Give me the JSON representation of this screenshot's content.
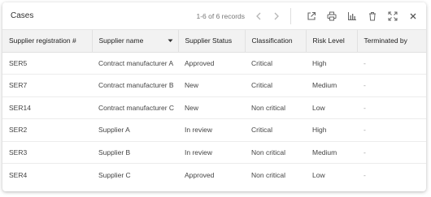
{
  "header": {
    "title": "Cases",
    "records": "1-6 of 6 records"
  },
  "toolbar": {
    "icons": [
      "external-link-icon",
      "print-icon",
      "bar-chart-icon",
      "trash-icon",
      "expand-icon",
      "close-icon"
    ]
  },
  "table": {
    "columns": [
      "Supplier registration #",
      "Supplier name",
      "Supplier Status",
      "Classification",
      "Risk Level",
      "Terminated by"
    ],
    "rows": [
      [
        "SER5",
        "Contract manufacturer A",
        "Approved",
        "Critical",
        "High",
        "-"
      ],
      [
        "SER7",
        "Contract manufacturer B",
        "New",
        "Critical",
        "Medium",
        "-"
      ],
      [
        "SER14",
        "Contract manufacturer C",
        "New",
        "Non critical",
        "Low",
        "-"
      ],
      [
        "SER2",
        "Supplier A",
        "In review",
        "Critical",
        "High",
        "-"
      ],
      [
        "SER3",
        "Supplier B",
        "In review",
        "Non critical",
        "Medium",
        "-"
      ],
      [
        "SER4",
        "Supplier C",
        "Approved",
        "Non critical",
        "Low",
        "-"
      ]
    ]
  }
}
